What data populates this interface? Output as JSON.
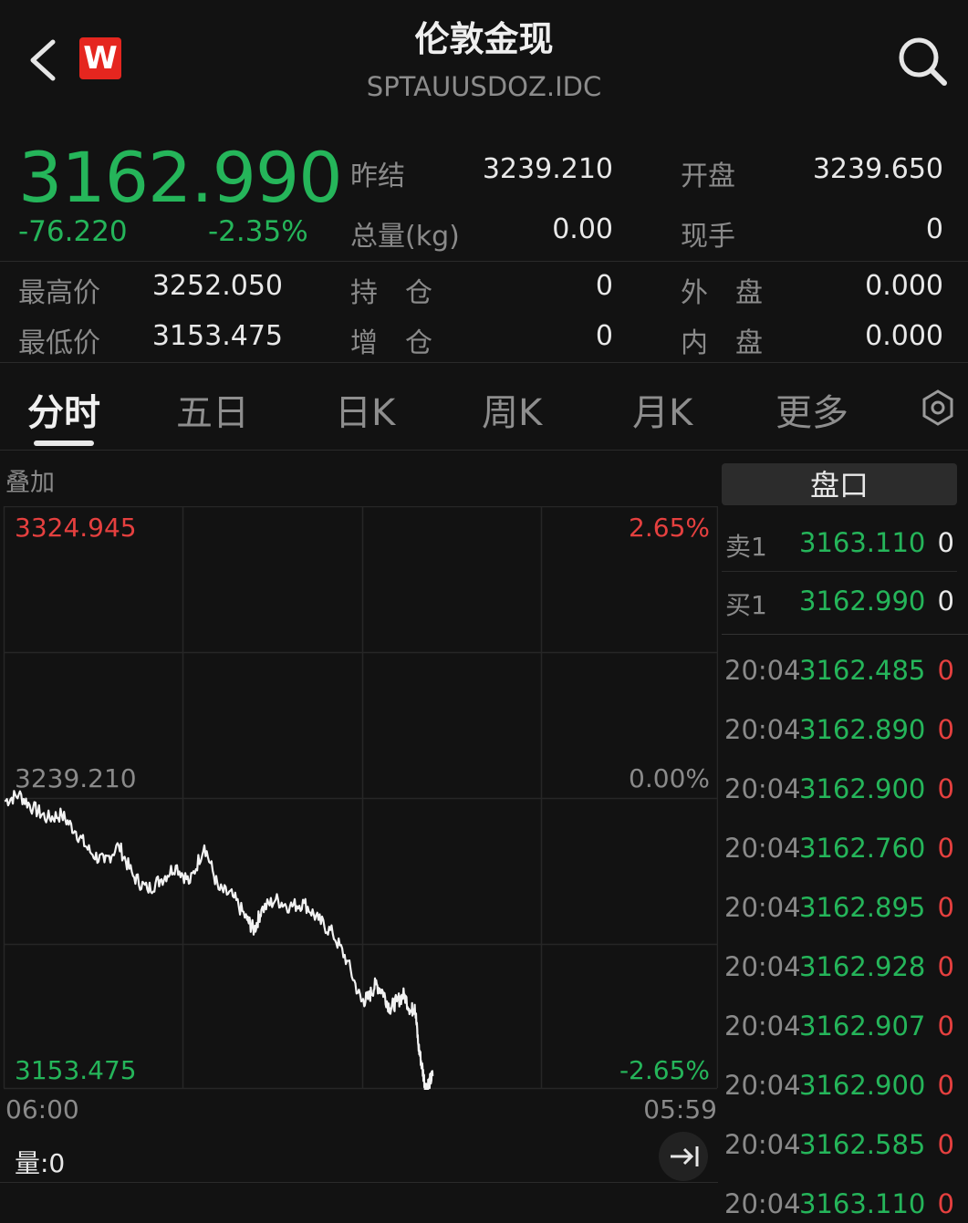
{
  "header": {
    "title": "伦敦金现",
    "subtitle": "SPTAUUSDOZ.IDC",
    "logo_text": "W",
    "icons": [
      "back-icon",
      "search-icon"
    ]
  },
  "quote": {
    "last_price": "3162.990",
    "change": "-76.220",
    "change_pct": "-2.35%",
    "fields": [
      {
        "label": "昨结",
        "value": "3239.210"
      },
      {
        "label": "开盘",
        "value": "3239.650"
      },
      {
        "label": "总量(kg)",
        "value": "0.00"
      },
      {
        "label": "现手",
        "value": "0"
      },
      {
        "label": "最高价",
        "value": "3252.050"
      },
      {
        "label": "持　仓",
        "value": "0"
      },
      {
        "label": "外　盘",
        "value": "0.000"
      },
      {
        "label": "最低价",
        "value": "3153.475"
      },
      {
        "label": "增　仓",
        "value": "0"
      },
      {
        "label": "内　盘",
        "value": "0.000"
      }
    ]
  },
  "tabs": [
    "分时",
    "五日",
    "日K",
    "周K",
    "月K",
    "更多"
  ],
  "chart": {
    "overlay_label": "叠加",
    "y_top_price": "3324.945",
    "y_mid_price": "3239.210",
    "y_bottom_price": "3153.475",
    "y_top_pct": "2.65%",
    "y_mid_pct": "0.00%",
    "y_bottom_pct": "-2.65%",
    "x_start": "06:00",
    "x_end": "05:59",
    "volume_label": "量:0"
  },
  "chart_data": {
    "type": "line",
    "ylim": [
      3153.475,
      3324.945
    ],
    "xlim_fraction_of_session": [
      0,
      1
    ],
    "series": [
      {
        "values_fraction_x": [
          0,
          0.02,
          0.04,
          0.06,
          0.08,
          0.1,
          0.12,
          0.14,
          0.16,
          0.18,
          0.2,
          0.22,
          0.24,
          0.26,
          0.28,
          0.3,
          0.32,
          0.34,
          0.35,
          0.36,
          0.38,
          0.4,
          0.42,
          0.44,
          0.46,
          0.48,
          0.5,
          0.51,
          0.52,
          0.53,
          0.54,
          0.55,
          0.56,
          0.57,
          0.575,
          0.58,
          0.585,
          0.59,
          0.595,
          0.6
        ],
        "values_price": [
          3238,
          3240,
          3236,
          3233,
          3234,
          3229,
          3223,
          3220,
          3225,
          3216,
          3212,
          3215,
          3219,
          3214,
          3225,
          3212,
          3210,
          3203,
          3200,
          3206,
          3209,
          3207,
          3208,
          3203,
          3199,
          3191,
          3179,
          3180,
          3184,
          3182,
          3177,
          3179,
          3181,
          3176,
          3178,
          3166,
          3160,
          3153.5,
          3155,
          3157
        ]
      }
    ]
  },
  "order_book": {
    "header": "盘口",
    "asks_bids": [
      {
        "label": "卖1",
        "price": "3163.110",
        "vol": "0"
      },
      {
        "label": "买1",
        "price": "3162.990",
        "vol": "0"
      }
    ],
    "ticks": [
      {
        "time": "20:04",
        "price": "3162.485",
        "vol": "0"
      },
      {
        "time": "20:04",
        "price": "3162.890",
        "vol": "0"
      },
      {
        "time": "20:04",
        "price": "3162.900",
        "vol": "0"
      },
      {
        "time": "20:04",
        "price": "3162.760",
        "vol": "0"
      },
      {
        "time": "20:04",
        "price": "3162.895",
        "vol": "0"
      },
      {
        "time": "20:04",
        "price": "3162.928",
        "vol": "0"
      },
      {
        "time": "20:04",
        "price": "3162.907",
        "vol": "0"
      },
      {
        "time": "20:04",
        "price": "3162.900",
        "vol": "0"
      },
      {
        "time": "20:04",
        "price": "3162.585",
        "vol": "0"
      },
      {
        "time": "20:04",
        "price": "3163.110",
        "vol": "0"
      }
    ]
  },
  "colors": {
    "up": "#e5403f",
    "down": "#25b55a",
    "background": "#121212"
  }
}
